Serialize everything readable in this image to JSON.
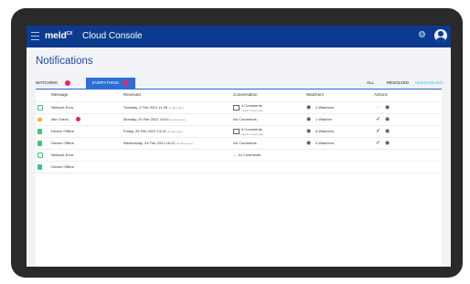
{
  "app": {
    "brand": "meld",
    "brand_sup": "CX",
    "title": "Cloud Console",
    "icons": [
      "menu-icon",
      "settings-icon",
      "user-avatar-icon"
    ]
  },
  "page": {
    "title": "Notifications",
    "tabs": [
      {
        "label": "WATCHING",
        "badge": "1"
      },
      {
        "label": "EVERYTHING",
        "badge": "6"
      }
    ],
    "filters": [
      "ALL",
      "RESOLVED",
      "UNRESOLVED"
    ],
    "active_filter": "UNRESOLVED"
  },
  "table": {
    "columns": [
      "Message",
      "Received",
      "Conversation",
      "Watchers",
      "Actions"
    ],
    "rows": [
      {
        "message": "Network Error",
        "icon": "box-icon",
        "badge": "",
        "received": "Tuesday, 2 Feb 2021 11:36",
        "received_ago": "(2 days ago)",
        "conversation": "4 Comments",
        "conversation_sub": "Latest 9 days ago",
        "watchers": "2 Watchers",
        "actions": [
          "check-light",
          "eye"
        ]
      },
      {
        "message": "Idle Check",
        "icon": "mail-icon",
        "badge": "1",
        "received": "Monday, 20 Feb 2021 10:04",
        "received_ago": "(4 days ago)",
        "conversation": "No Comments",
        "conversation_sub": "",
        "watchers": "1 Watcher",
        "actions": [
          "check",
          "eye"
        ]
      },
      {
        "message": "Device Offline",
        "icon": "device-icon",
        "badge": "",
        "received": "Friday, 26 Feb 2021 13:15",
        "received_ago": "(4 days ago)",
        "conversation": "6 Comments",
        "conversation_sub": "Latest 4 days ago",
        "watchers": "6 Watchers",
        "actions": [
          "check",
          "eye"
        ]
      },
      {
        "message": "Device Offline",
        "icon": "device-icon",
        "badge": "",
        "received": "Wednesday, 24 Feb 2021 16:22",
        "received_ago": "(11 days ago)",
        "conversation": "No Comments",
        "conversation_sub": "",
        "watchers": "0 Watchers",
        "actions": [
          "check",
          "eye"
        ]
      },
      {
        "message": "Network Error",
        "icon": "box-icon",
        "badge": "",
        "received": "",
        "received_ago": "",
        "conversation": "14 Comments",
        "conversation_sub": "",
        "watchers": "",
        "actions": []
      },
      {
        "message": "Device Offline",
        "icon": "device-icon",
        "badge": "",
        "received": "",
        "received_ago": "",
        "conversation": "",
        "conversation_sub": "",
        "watchers": "",
        "actions": []
      }
    ]
  },
  "colors": {
    "appbar": "#0b3b8f",
    "accent": "#2a6fd6",
    "badge": "#e6246d",
    "success": "#40c57b"
  }
}
